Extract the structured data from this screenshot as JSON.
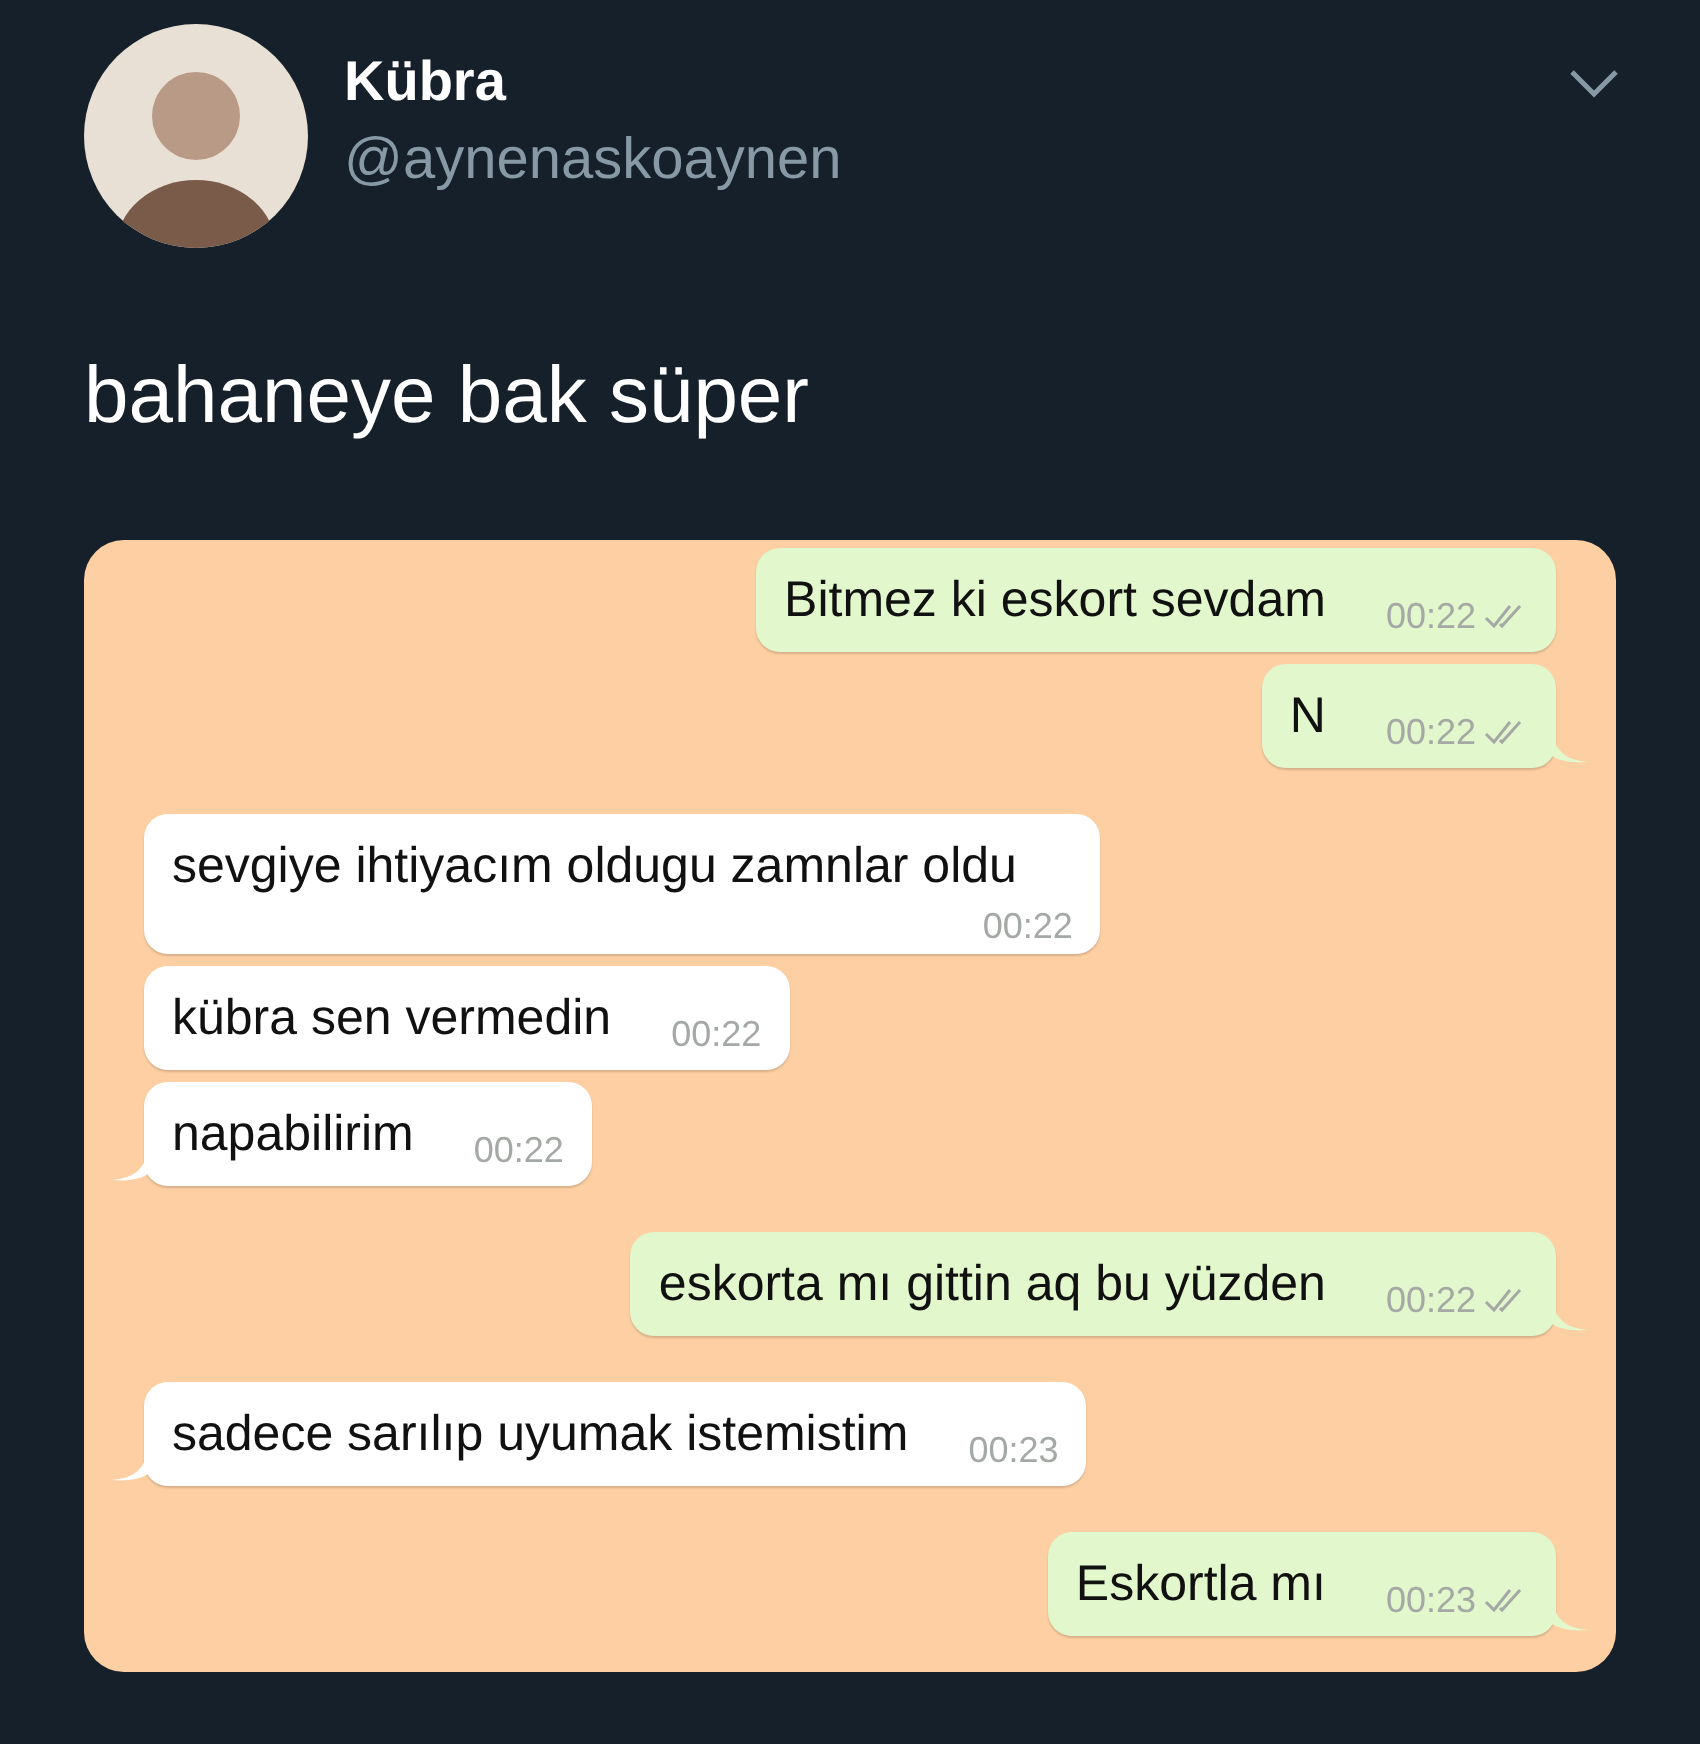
{
  "tweet": {
    "name": "Kübra",
    "handle": "@aynenaskoaynen",
    "text": "bahaneye bak süper"
  },
  "chat": {
    "messages": [
      {
        "kind": "sent",
        "text": "Bitmez ki eskort sevdam",
        "time": "00:22",
        "tail": false,
        "time_below": false
      },
      {
        "kind": "sent",
        "text": "N",
        "time": "00:22",
        "tail": true,
        "time_below": false
      },
      {
        "kind": "received",
        "text": "sevgiye ihtiyacım oldugu zamnlar oldu",
        "time": "00:22",
        "tail": false,
        "time_below": true
      },
      {
        "kind": "received",
        "text": "kübra sen vermedin",
        "time": "00:22",
        "tail": false,
        "time_below": false
      },
      {
        "kind": "received",
        "text": "napabilirim",
        "time": "00:22",
        "tail": true,
        "time_below": false
      },
      {
        "kind": "sent",
        "text": "eskorta mı gittin aq bu yüzden",
        "time": "00:22",
        "tail": true,
        "time_below": false
      },
      {
        "kind": "received",
        "text": "sadece sarılıp uyumak istemistim",
        "time": "00:23",
        "tail": true,
        "time_below": false
      },
      {
        "kind": "sent",
        "text": "Eskortla mı",
        "time": "00:23",
        "tail": true,
        "time_below": false
      }
    ]
  }
}
